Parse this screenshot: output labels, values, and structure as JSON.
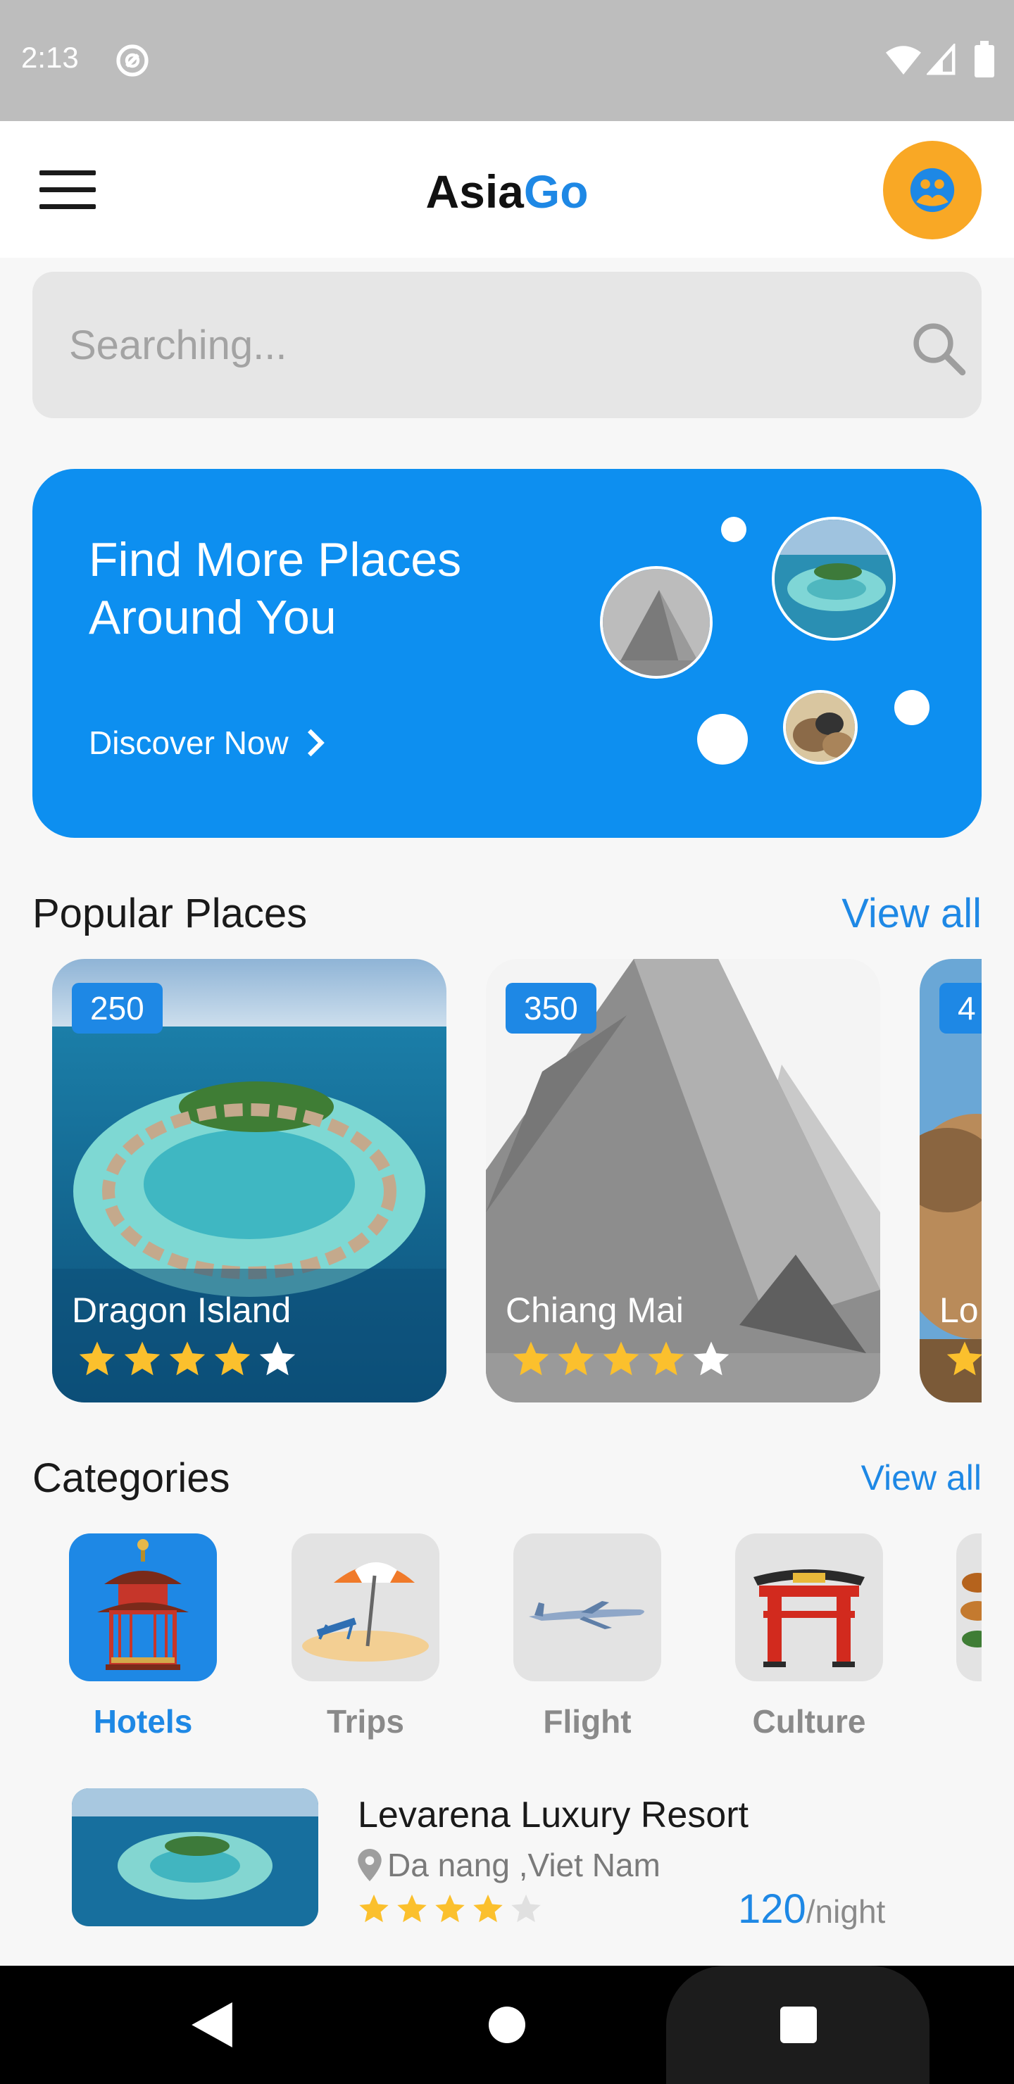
{
  "status_bar": {
    "time": "2:13",
    "icons": [
      "at-sign-icon",
      "wifi-icon",
      "signal-icon",
      "battery-icon"
    ]
  },
  "app_bar": {
    "title_part1": "Asia",
    "title_part2": "Go",
    "icons": [
      "menu-icon",
      "profile-icon"
    ]
  },
  "search": {
    "placeholder": "Searching...",
    "value": "",
    "icon": "search-icon"
  },
  "banner": {
    "line1": "Find More Places",
    "line2": "Around You",
    "cta": "Discover Now",
    "cta_icon": "chevron-right-icon"
  },
  "popular": {
    "title": "Popular Places",
    "view_all": "View all",
    "cards": [
      {
        "price": "250",
        "name": "Dragon Island",
        "rating": 4
      },
      {
        "price": "350",
        "name": "Chiang Mai",
        "rating": 4
      },
      {
        "price": "4",
        "name": "Lo",
        "rating": 1
      }
    ]
  },
  "categories": {
    "title": "Categories",
    "view_all": "View all",
    "items": [
      {
        "label": "Hotels",
        "icon": "pagoda-icon",
        "active": true
      },
      {
        "label": "Trips",
        "icon": "beach-umbrella-icon",
        "active": false
      },
      {
        "label": "Flight",
        "icon": "airplane-icon",
        "active": false
      },
      {
        "label": "Culture",
        "icon": "asian-gate-icon",
        "active": false
      },
      {
        "label": "",
        "icon": "food-icon",
        "active": false
      }
    ]
  },
  "hotels": [
    {
      "name": "Levarena Luxury Resort",
      "location": "Da nang ,Viet Nam",
      "rating": 4,
      "price": "120",
      "unit": "/night"
    }
  ],
  "colors": {
    "accent": "#1e88e5",
    "banner": "#0d8ff0",
    "avatar": "#f9a825",
    "star": "#fbc02d"
  }
}
